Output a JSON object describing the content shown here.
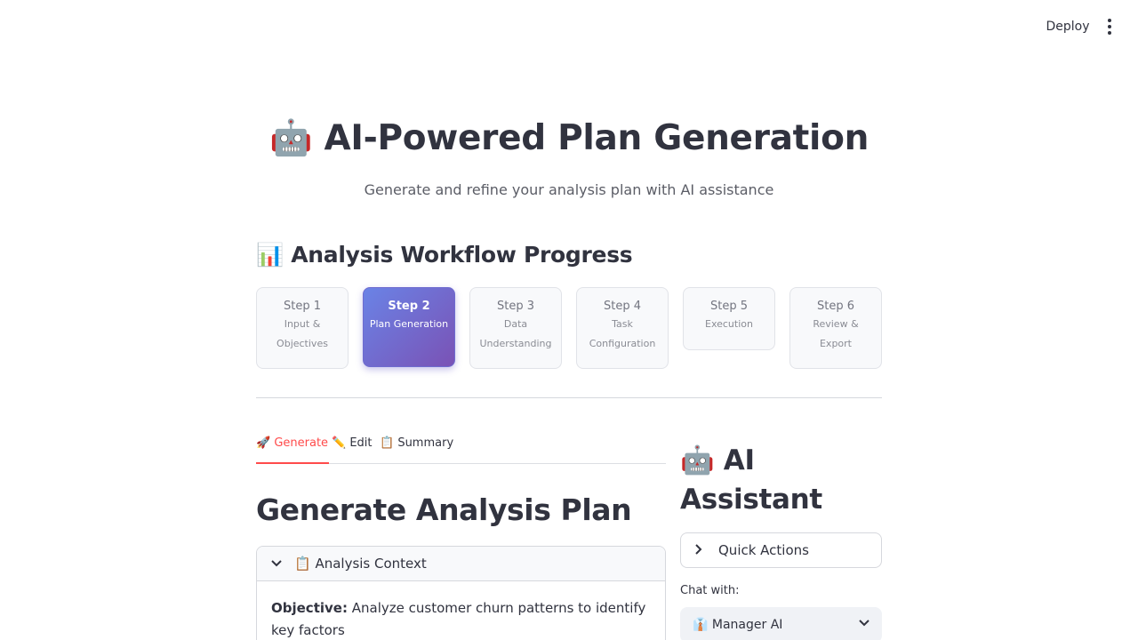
{
  "toolbar": {
    "deploy_label": "Deploy",
    "menu_icon": "kebab-menu-icon"
  },
  "header": {
    "title": "🤖 AI-Powered Plan Generation",
    "subtitle": "Generate and refine your analysis plan with AI assistance"
  },
  "workflow": {
    "heading": "📊 Analysis Workflow Progress",
    "active_step": 2,
    "steps": [
      {
        "number": "Step 1",
        "label": "Input & Objectives"
      },
      {
        "number": "Step 2",
        "label": "Plan Generation"
      },
      {
        "number": "Step 3",
        "label": "Data Understanding"
      },
      {
        "number": "Step 4",
        "label": "Task Configuration"
      },
      {
        "number": "Step 5",
        "label": "Execution"
      },
      {
        "number": "Step 6",
        "label": "Review & Export"
      }
    ],
    "active_gradient": [
      "#6a83e6",
      "#7a52b5"
    ]
  },
  "tabs": [
    {
      "label": "🚀 Generate",
      "active": true
    },
    {
      "label": "✏️ Edit",
      "active": false
    },
    {
      "label": "📋 Summary",
      "active": false
    }
  ],
  "accent_color": "#ff4b4b",
  "main": {
    "title": "Generate Analysis Plan",
    "context": {
      "header": "📋 Analysis Context",
      "objective_label": "Objective:",
      "objective_value": "Analyze customer churn patterns to identify key factors"
    }
  },
  "assistant": {
    "title": "🤖 AI Assistant",
    "quick_actions_label": "Quick Actions",
    "chat_with_label": "Chat with:",
    "chat_with_value": "👔 Manager AI"
  }
}
